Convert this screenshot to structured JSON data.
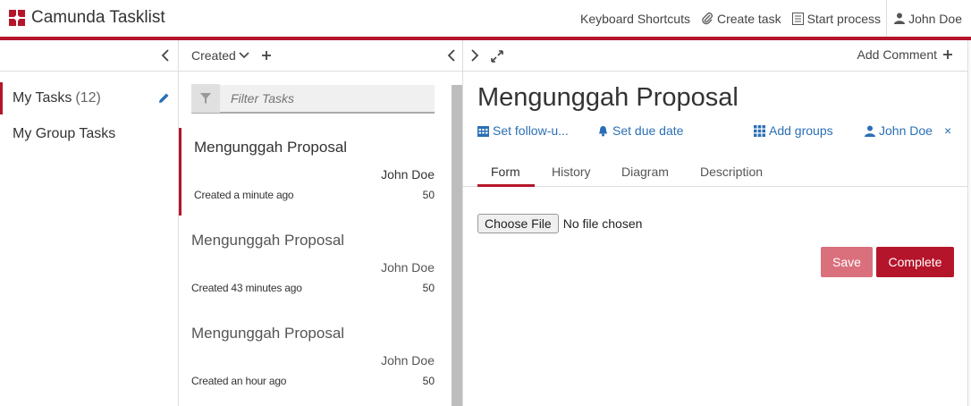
{
  "header": {
    "app_title": "Camunda Tasklist",
    "keyboard_shortcuts": "Keyboard Shortcuts",
    "create_task": "Create task",
    "start_process": "Start process",
    "user": "John Doe",
    "accent_color": "#b5152b"
  },
  "filters": {
    "items": [
      {
        "label": "My Tasks",
        "count": "(12)",
        "active": true
      },
      {
        "label": "My Group Tasks",
        "count": "",
        "active": false
      }
    ]
  },
  "list": {
    "sort_label": "Created",
    "filter_placeholder": "Filter Tasks",
    "tasks": [
      {
        "name": "Mengunggah Proposal",
        "assignee": "John Doe",
        "created": "Created a minute ago",
        "priority": "50"
      },
      {
        "name": "Mengunggah Proposal",
        "assignee": "John Doe",
        "created": "Created 43 minutes ago",
        "priority": "50"
      },
      {
        "name": "Mengunggah Proposal",
        "assignee": "John Doe",
        "created": "Created an hour ago",
        "priority": "50"
      }
    ]
  },
  "detail": {
    "add_comment": "Add Comment",
    "title": "Mengunggah Proposal",
    "follow_up": "Set follow-u...",
    "due_date": "Set due date",
    "add_groups": "Add groups",
    "assignee": "John Doe",
    "remove": "×",
    "tabs": [
      "Form",
      "History",
      "Diagram",
      "Description"
    ],
    "choose_file": "Choose File",
    "file_status": "No file chosen",
    "save": "Save",
    "complete": "Complete"
  }
}
